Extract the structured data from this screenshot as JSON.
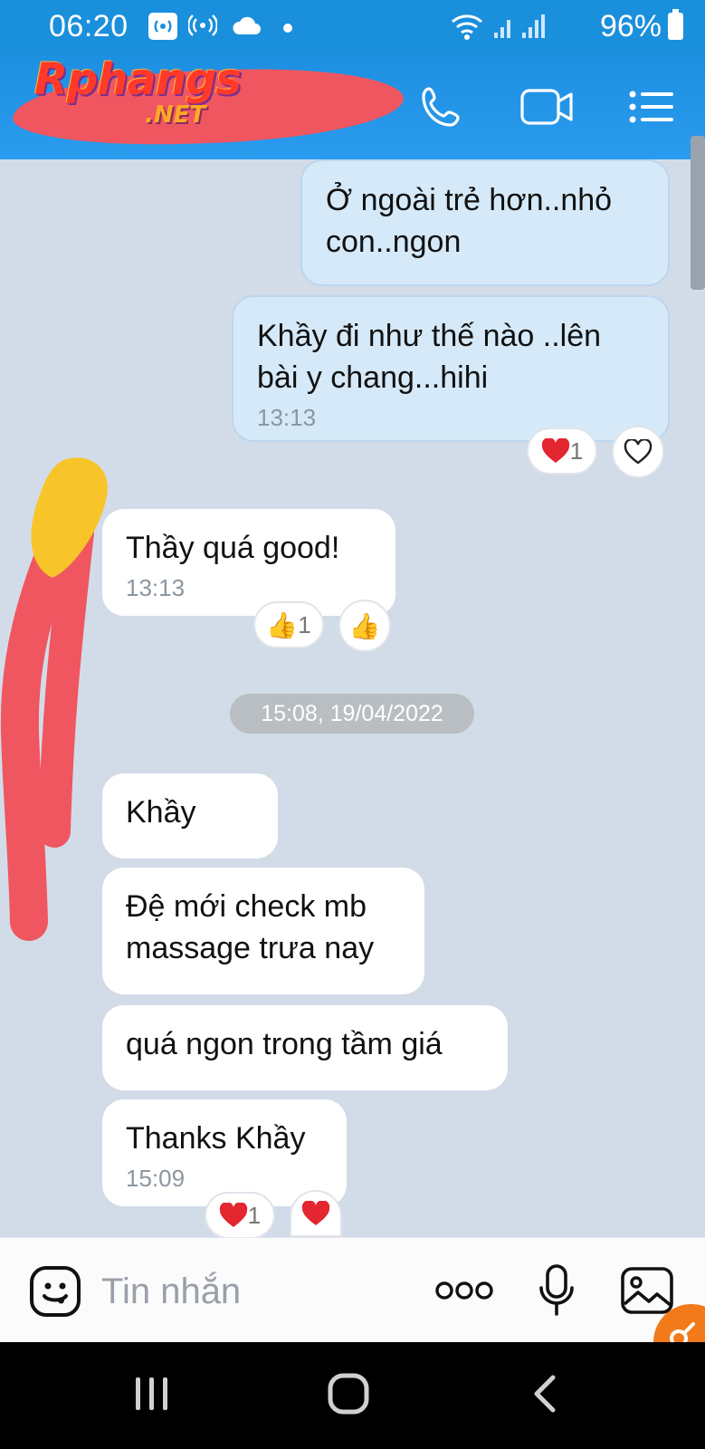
{
  "status_bar": {
    "time": "06:20",
    "battery": "96%",
    "icons": [
      "hotspot-icon",
      "wifi-calling-icon",
      "cloud-icon",
      "dot-icon",
      "wifi-icon",
      "signal-icon",
      "battery-icon"
    ]
  },
  "header": {
    "logo_main": "Rphangs",
    "logo_sub": ".NET",
    "actions": [
      "phone-icon",
      "video-call-icon",
      "menu-icon"
    ]
  },
  "messages": [
    {
      "side": "out",
      "text": "Ở ngoài trẻ hơn..nhỏ con..ngon",
      "time": ""
    },
    {
      "side": "out",
      "text": "Khầy đi như thế nào ..lên bài y chang...hihi",
      "time": "13:13",
      "reaction_count": "1"
    },
    {
      "side": "in",
      "text": "Thầy quá good!",
      "time": "13:13",
      "reaction_count": "1"
    },
    {
      "side": "in",
      "text": "Khầy",
      "time": ""
    },
    {
      "side": "in",
      "text": "Đệ mới check mb massage trưa nay",
      "time": ""
    },
    {
      "side": "in",
      "text": "quá ngon trong tầm giá",
      "time": ""
    },
    {
      "side": "in",
      "text": "Thanks Khầy",
      "time": "15:09",
      "reaction_count": "1"
    }
  ],
  "date_separator": "15:08, 19/04/2022",
  "composer": {
    "placeholder": "Tin nhắn",
    "icons": [
      "emoji-icon",
      "more-icon",
      "microphone-icon",
      "image-icon"
    ]
  },
  "colors": {
    "header": "#1a8fdc",
    "chat_bg": "#d2dce8",
    "outgoing_bubble": "#d5e9f8",
    "incoming_bubble": "#ffffff",
    "scribble": "#f05660",
    "fab": "#f27a1a"
  }
}
